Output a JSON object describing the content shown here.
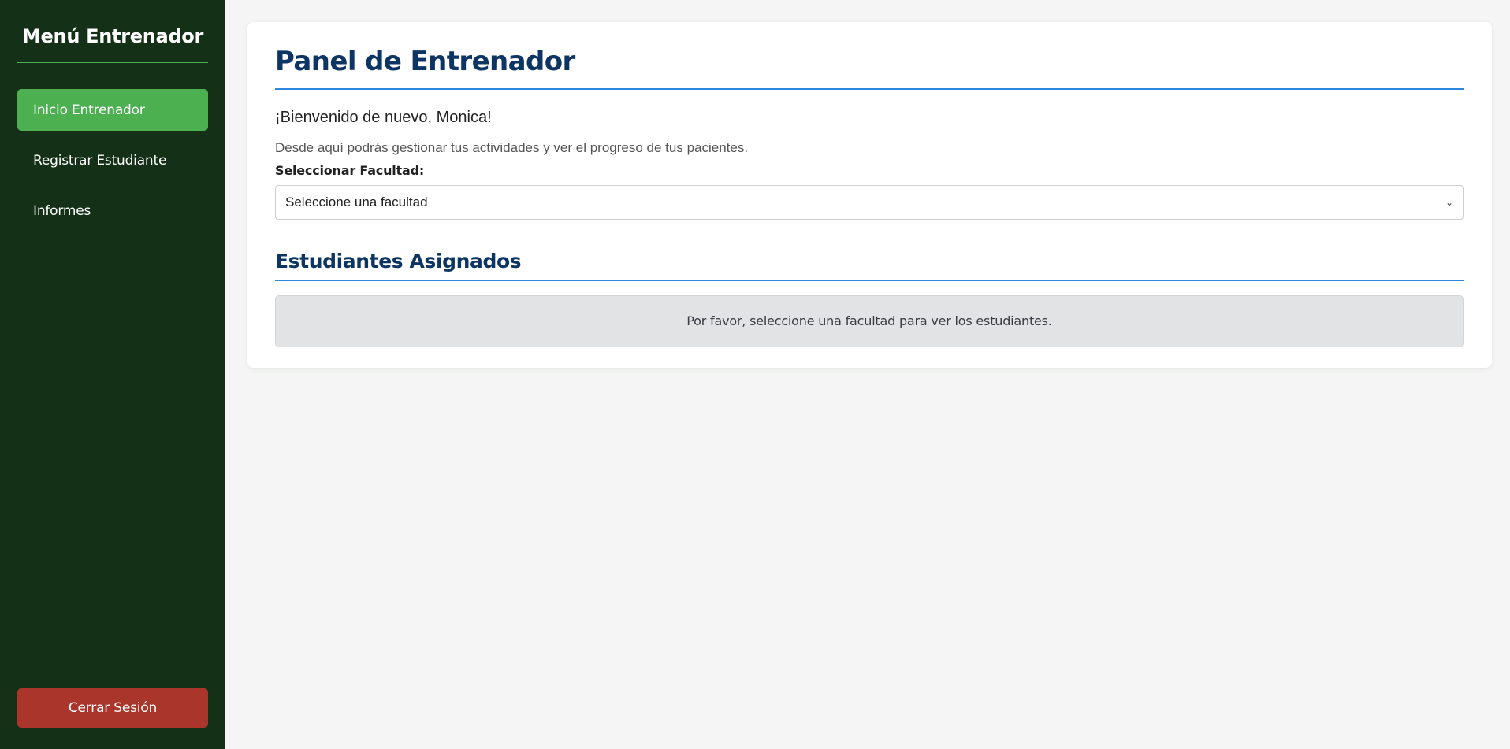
{
  "sidebar": {
    "title": "Menú Entrenador",
    "items": [
      {
        "label": "Inicio Entrenador",
        "active": true
      },
      {
        "label": "Registrar Estudiante",
        "active": false
      },
      {
        "label": "Informes",
        "active": false
      }
    ],
    "logout_label": "Cerrar Sesión"
  },
  "main": {
    "title": "Panel de Entrenador",
    "welcome": "¡Bienvenido de nuevo, Monica!",
    "description": "Desde aquí podrás gestionar tus actividades y ver el progreso de tus pacientes.",
    "faculty_label": "Seleccionar Facultad:",
    "faculty_select": {
      "selected": "Seleccione una facultad",
      "icon": "chevron-down-icon"
    },
    "students_title": "Estudiantes Asignados",
    "students_empty_message": "Por favor, seleccione una facultad para ver los estudiantes."
  },
  "colors": {
    "sidebar_bg": "#143118",
    "active_item": "#4caf50",
    "logout_bg": "#a9352b",
    "title": "#0d3563",
    "accent_line": "#2e86de"
  }
}
